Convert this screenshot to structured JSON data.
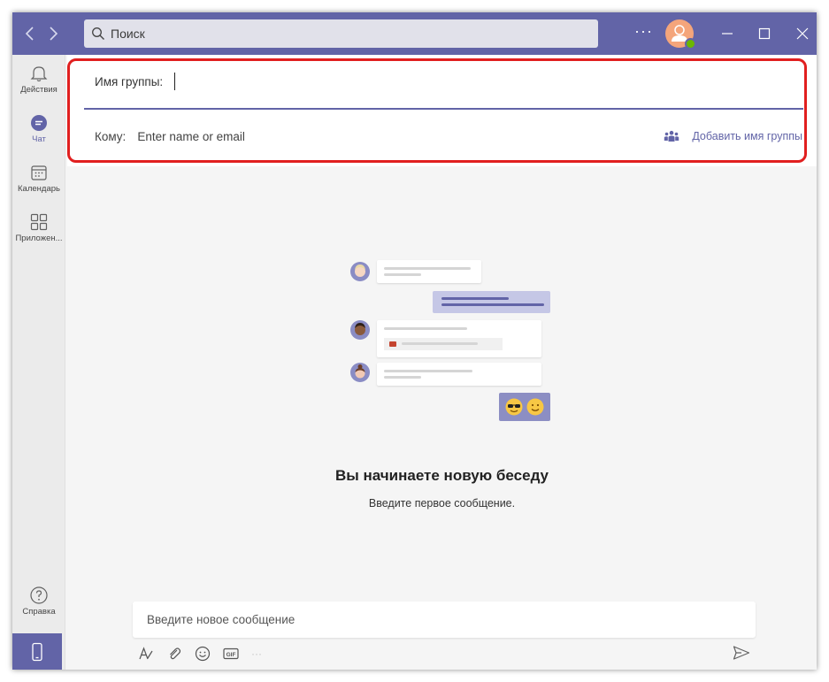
{
  "titlebar": {
    "search_placeholder": "Поиск",
    "more_label": "···"
  },
  "rail": {
    "items": [
      {
        "label": "Действия",
        "icon": "bell-icon"
      },
      {
        "label": "Чат",
        "icon": "chat-icon"
      },
      {
        "label": "Календарь",
        "icon": "calendar-icon"
      },
      {
        "label": "Приложен...",
        "icon": "apps-icon"
      },
      {
        "label": "Справка",
        "icon": "help-icon"
      }
    ]
  },
  "header": {
    "group_name_label": "Имя группы:",
    "group_name_value": "",
    "to_label": "Кому:",
    "to_placeholder": "Enter name or email",
    "add_group_name": "Добавить имя группы"
  },
  "empty_state": {
    "title": "Вы начинаете новую беседу",
    "subtitle": "Введите первое сообщение."
  },
  "compose": {
    "placeholder": "Введите новое сообщение",
    "more": "···"
  },
  "colors": {
    "brand": "#6264a7",
    "highlight": "#e11f1f",
    "presence": "#6bb700"
  }
}
